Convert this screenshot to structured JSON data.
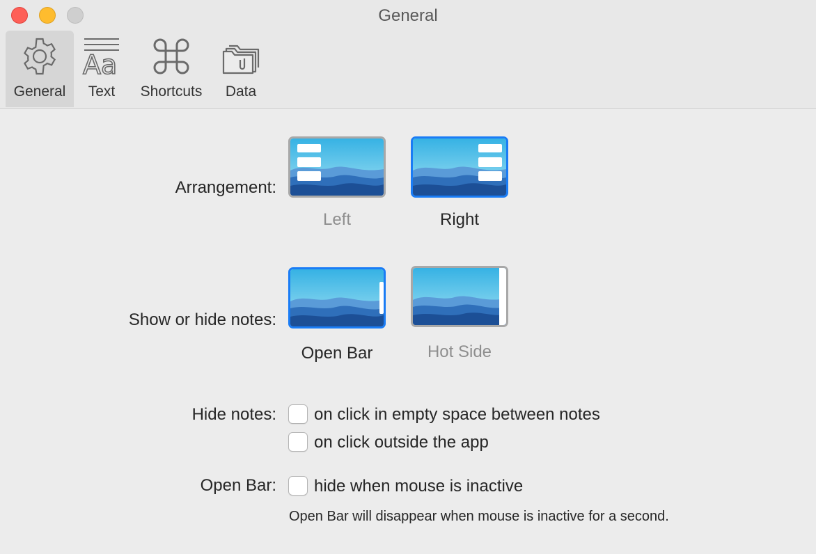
{
  "window": {
    "title": "General"
  },
  "toolbar": {
    "tabs": [
      {
        "label": "General",
        "icon": "gear-icon",
        "active": true
      },
      {
        "label": "Text",
        "icon": "text-format-icon"
      },
      {
        "label": "Shortcuts",
        "icon": "command-key-icon"
      },
      {
        "label": "Data",
        "icon": "folder-icon"
      }
    ]
  },
  "arrangement": {
    "label": "Arrangement:",
    "options": [
      {
        "caption": "Left",
        "selected": false
      },
      {
        "caption": "Right",
        "selected": true
      }
    ]
  },
  "show_hide": {
    "label": "Show or hide notes:",
    "options": [
      {
        "caption": "Open Bar",
        "selected": true
      },
      {
        "caption": "Hot Side",
        "selected": false
      }
    ]
  },
  "hide_notes": {
    "label": "Hide notes:",
    "options": [
      {
        "label": "on click in empty space between notes",
        "checked": false
      },
      {
        "label": "on click outside the app",
        "checked": false
      }
    ]
  },
  "open_bar": {
    "label": "Open Bar:",
    "option": {
      "label": "hide when mouse is inactive",
      "checked": false
    },
    "note": "Open Bar will disappear when mouse is inactive for a second."
  },
  "colors": {
    "accent": "#1a7cf5",
    "sky_top": "#3ab6e6",
    "sky_bottom": "#9ee0f2",
    "wave_dark": "#1c4f96"
  }
}
